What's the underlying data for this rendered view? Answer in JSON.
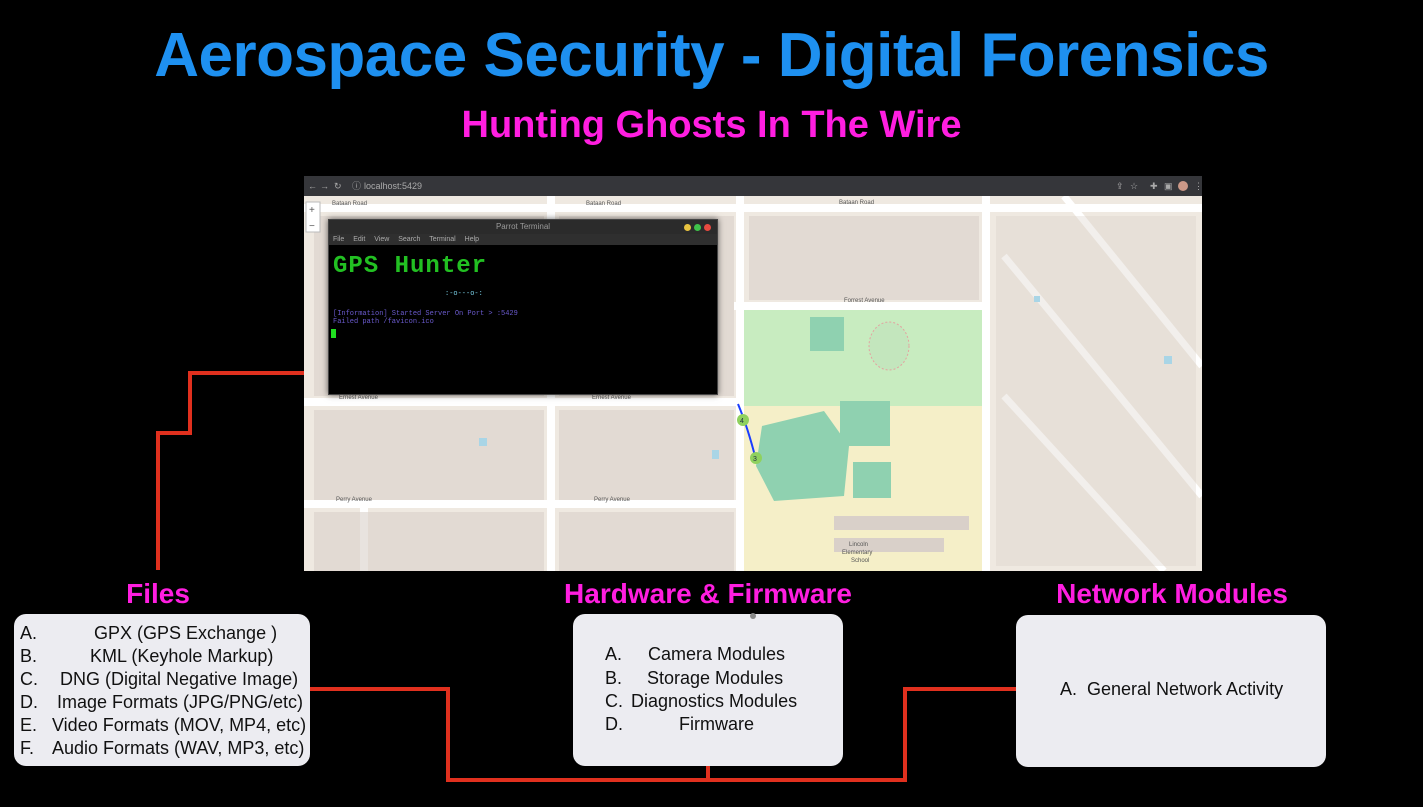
{
  "title": "Aerospace Security - Digital Forensics",
  "subtitle": "Hunting Ghosts In The Wire",
  "browser": {
    "url": "localhost:5429"
  },
  "terminal": {
    "title": "Parrot Terminal",
    "menu": [
      "File",
      "Edit",
      "View",
      "Search",
      "Terminal",
      "Help"
    ],
    "ascii_logo": "GPS Hunter",
    "ascii_tail": ":-o---o-:",
    "line1": "[Information] Started Server On Port > :5429",
    "line2": "Failed path  /favicon.ico"
  },
  "map": {
    "streets": [
      "Bataan Road",
      "Bataan Road",
      "Bataan Road",
      "Forrest Avenue",
      "Ernest Avenue",
      "Ernest Avenue",
      "Perry Avenue",
      "Perry Avenue",
      "Lincoln Elementary School"
    ],
    "markers": [
      "4",
      "3"
    ],
    "colors": {
      "park": "#c8ecc0",
      "water": "#a9d5e6",
      "school": "#f5efc8"
    }
  },
  "files": {
    "label": "Files",
    "items": [
      {
        "letter": "A.",
        "text": "GPX (GPS Exchange )"
      },
      {
        "letter": "B.",
        "text": "KML (Keyhole Markup)"
      },
      {
        "letter": "C.",
        "text": "DNG (Digital Negative Image)"
      },
      {
        "letter": "D.",
        "text": "Image Formats (JPG/PNG/etc)"
      },
      {
        "letter": "E.",
        "text": "Video Formats (MOV, MP4, etc)"
      },
      {
        "letter": "F.",
        "text": "Audio Formats (WAV, MP3, etc)"
      }
    ]
  },
  "hardware": {
    "label": "Hardware & Firmware",
    "items": [
      {
        "letter": "A.",
        "text": "Camera Modules"
      },
      {
        "letter": "B.",
        "text": "Storage Modules"
      },
      {
        "letter": "C.",
        "text": "Diagnostics Modules"
      },
      {
        "letter": "D.",
        "text": "Firmware"
      }
    ]
  },
  "network": {
    "label": "Network Modules",
    "items": [
      {
        "letter": "A.",
        "text": "General Network Activity"
      }
    ]
  },
  "colors": {
    "title": "#1e90f0",
    "accent": "#ff1ee0",
    "wire": "#e0301e"
  }
}
